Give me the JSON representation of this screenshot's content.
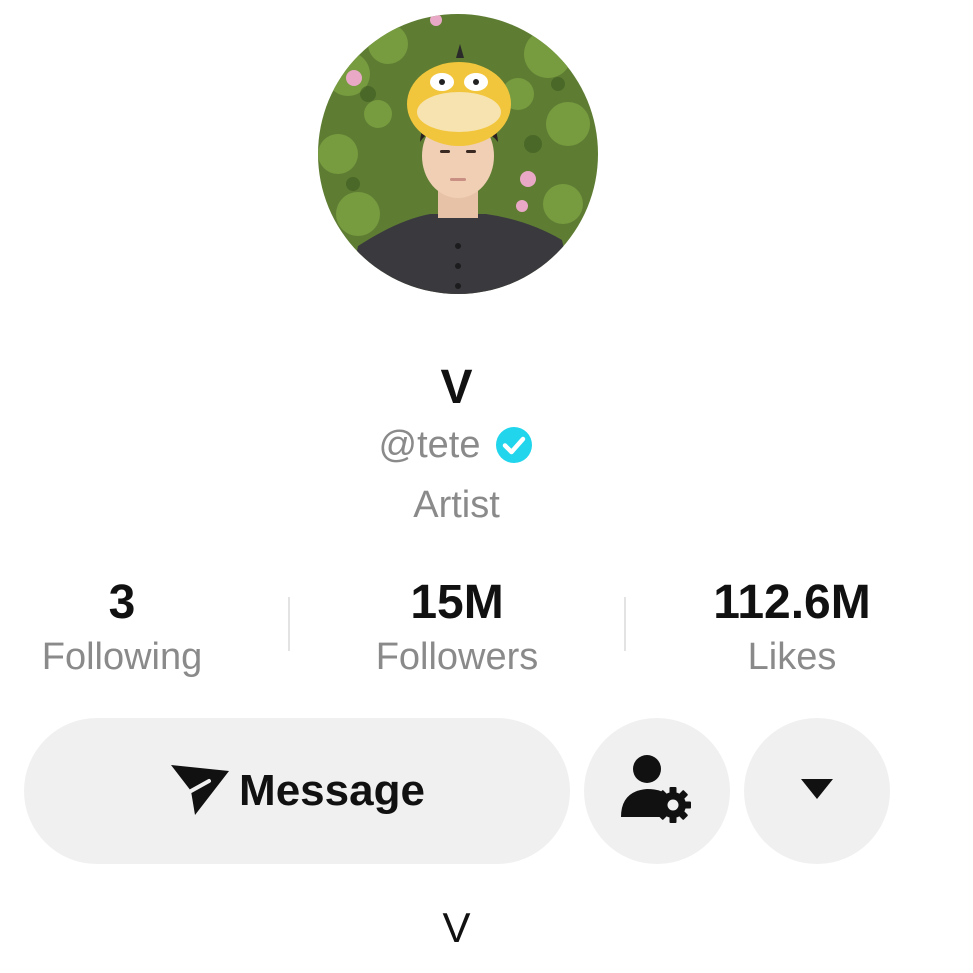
{
  "profile": {
    "display_name": "V",
    "handle": "@tete",
    "verified": true,
    "bio": "Artist",
    "avatar_description": "profile-photo"
  },
  "stats": [
    {
      "value": "3",
      "label": "Following"
    },
    {
      "value": "15M",
      "label": "Followers"
    },
    {
      "value": "112.6M",
      "label": "Likes"
    }
  ],
  "actions": {
    "message_label": "Message",
    "message_icon": "send-icon",
    "user_settings_icon": "user-gear-icon",
    "more_icon": "caret-down-icon"
  },
  "footer": {
    "text": "V"
  },
  "colors": {
    "verified": "#20D5EC",
    "button_bg": "#F0F0F0",
    "secondary_text": "#8A8A8A"
  }
}
